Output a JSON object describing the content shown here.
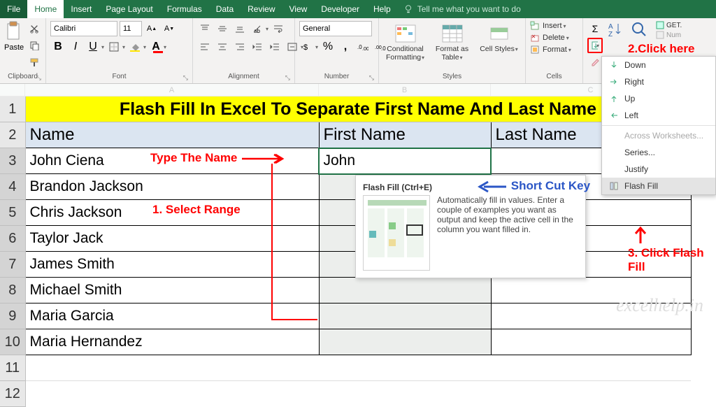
{
  "tabs": {
    "file": "File",
    "items": [
      "Home",
      "Insert",
      "Page Layout",
      "Formulas",
      "Data",
      "Review",
      "View",
      "Developer",
      "Help"
    ],
    "active": "Home",
    "tell_me": "Tell me what you want to do"
  },
  "ribbon": {
    "clipboard": {
      "paste": "Paste",
      "label": "Clipboard"
    },
    "font": {
      "name": "Calibri",
      "size": "11",
      "label": "Font"
    },
    "alignment": {
      "label": "Alignment"
    },
    "number": {
      "format": "General",
      "label": "Number"
    },
    "styles": {
      "cond": "Conditional Formatting",
      "table": "Format as Table",
      "cell": "Cell Styles",
      "label": "Styles"
    },
    "cells": {
      "insert": "Insert",
      "delete": "Delete",
      "format": "Format",
      "label": "Cells"
    },
    "editing": {
      "get": "GET."
    }
  },
  "fill_menu": {
    "items": [
      "Down",
      "Right",
      "Up",
      "Left",
      "Across Worksheets...",
      "Series...",
      "Justify",
      "Flash Fill"
    ]
  },
  "sheet": {
    "cols": [
      "A",
      "B",
      "C"
    ],
    "title": "Flash Fill In Excel To Separate First Name And Last Name",
    "headers": [
      "Name",
      "First Name",
      "Last Name"
    ],
    "rows": [
      {
        "a": "John Ciena",
        "b": "John",
        "c": ""
      },
      {
        "a": "Brandon Jackson",
        "b": "",
        "c": ""
      },
      {
        "a": "Chris Jackson",
        "b": "",
        "c": ""
      },
      {
        "a": "Taylor Jack",
        "b": "",
        "c": ""
      },
      {
        "a": "James Smith",
        "b": "",
        "c": ""
      },
      {
        "a": "Michael Smith",
        "b": "",
        "c": ""
      },
      {
        "a": "Maria Garcia",
        "b": "",
        "c": ""
      },
      {
        "a": "Maria Hernandez",
        "b": "",
        "c": ""
      }
    ]
  },
  "screentip": {
    "title": "Flash Fill (Ctrl+E)",
    "body": "Automatically fill in values. Enter a couple of examples you want as output and keep the active cell in the column you want filled in."
  },
  "anno": {
    "type_name": "Type The Name",
    "select_range": "1. Select Range",
    "click_here": "2.Click here",
    "short_cut": "Short Cut Key",
    "click_flash": "3. Click Flash Fill"
  },
  "watermark": "excelhelp.in"
}
